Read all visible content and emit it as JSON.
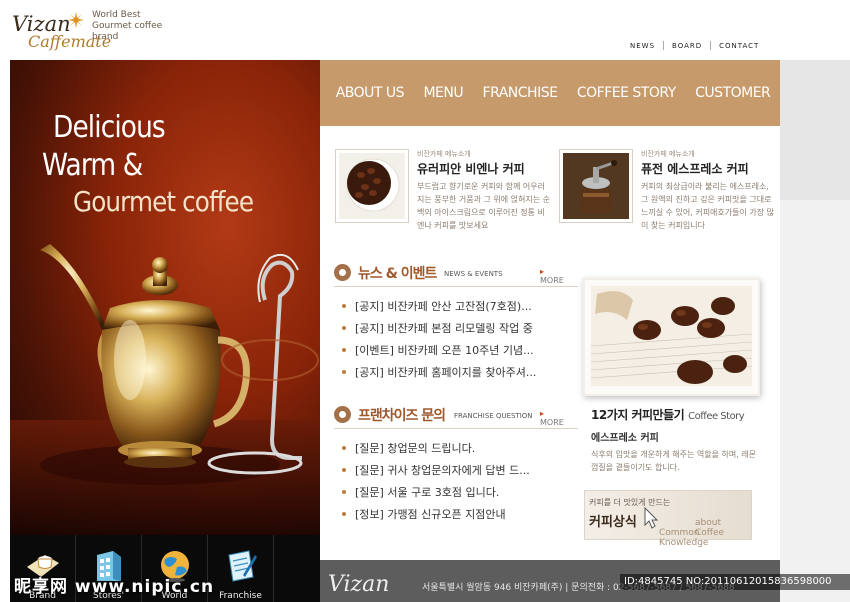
{
  "brand": {
    "logo_line1": "Vizan",
    "logo_line2": "Caffemate",
    "tagline1": "World Best",
    "tagline2": "Gourmet coffee brand"
  },
  "top_nav": [
    "NEWS",
    "BOARD",
    "CONTACT"
  ],
  "hero": {
    "line1": "Delicious",
    "line2": "Warm &",
    "line3": "Gourmet coffee"
  },
  "main_nav": [
    "ABOUT US",
    "MENU",
    "FRANCHISE",
    "COFFEE STORY",
    "CUSTOMER"
  ],
  "products": [
    {
      "sub": "비잔카페 메뉴소개",
      "title": "유러피안 비엔나 커피",
      "desc": "부드럽고 향기로운 커피와 함께 어우러지는 풍부한 거품과 그 위에 얹혀지는 순백의 아이스크림으로 이루어진 정통 비엔나 커피를 맛보세요"
    },
    {
      "sub": "비잔카페 메뉴소개",
      "title": "퓨전 에스프레소 커피",
      "desc": "커피의 최상급이라 불리는 에스프레소, 그 원액의 진하고 깊은 커피맛을 그대로 느끼실 수 있어, 커피애호가들이 가장 많이 찾는 커피입니다"
    }
  ],
  "news": {
    "title": "뉴스 & 이벤트",
    "title_en": "NEWS & EVENTS",
    "more": "MORE",
    "items": [
      "[공지] 비잔카페 안산 고잔점(7호점)...",
      "[공지] 비잔카페 본점 리모델링 작업 중",
      "[이벤트] 비잔카페 오픈 10주년 기념...",
      "[공지] 비잔카페 홈페이지를 찾아주셔..."
    ]
  },
  "franchise": {
    "title": "프랜차이즈 문의",
    "title_en": "FRANCHISE QUESTION",
    "more": "MORE",
    "items": [
      "[질문] 창업문의 드립니다.",
      "[질문] 귀사 창업문의자에게 답변 드...",
      "[질문] 서울 구로 3호점 입니다.",
      "[정보] 가맹점 신규오픈 지점안내"
    ]
  },
  "story": {
    "title": "12가지 커피만들기",
    "title_en": "Coffee Story",
    "subtitle": "에스프레소 커피",
    "desc": "식후의 입맛을 개운하게 해주는 역할을 하며, 레몬껍질을 곁들이기도 합니다."
  },
  "knowledge": {
    "small": "커피를 더 맛있게 만드는",
    "big": "커피상식",
    "en1": "about Coffee",
    "en2": "Common Knowledge"
  },
  "bottom_icons": [
    "Brand",
    "Stores'",
    "World",
    "Franchise"
  ],
  "footer": {
    "logo": "Vizan",
    "address": "서울특별시 월암동 946 비잔카페(주)  |  문의전화 : 02-5687-5687 / 5687-5688"
  },
  "overlay": {
    "watermark": "昵享网 www.nipic.cn",
    "id_text": "ID:4845745 NO:20110612015836598000"
  }
}
